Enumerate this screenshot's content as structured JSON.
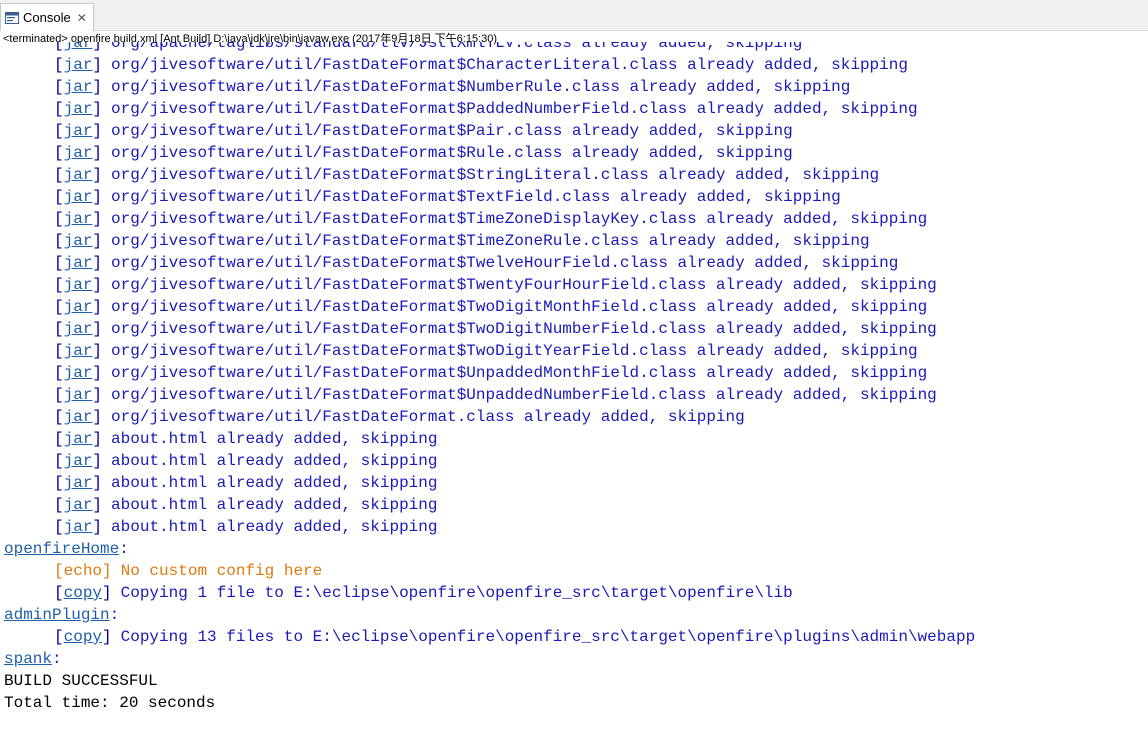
{
  "tab": {
    "label": "Console",
    "close": "✕"
  },
  "status": "<terminated> openfire build.xml [Ant Build] D:\\java\\jdk\\jre\\bin\\javaw.exe (2017年9月18日 下午6:15:30)",
  "colors": {
    "output": "#1a1ab8",
    "link": "#1f5fa8",
    "echo": "#e07a10",
    "text": "#000000"
  },
  "lines": [
    {
      "kind": "task",
      "tag": "jar",
      "text": "org/apache/taglibs/standard/tlv/JstlXmlTLV.class already added, skipping"
    },
    {
      "kind": "task",
      "tag": "jar",
      "text": "org/jivesoftware/util/FastDateFormat$CharacterLiteral.class already added, skipping"
    },
    {
      "kind": "task",
      "tag": "jar",
      "text": "org/jivesoftware/util/FastDateFormat$NumberRule.class already added, skipping"
    },
    {
      "kind": "task",
      "tag": "jar",
      "text": "org/jivesoftware/util/FastDateFormat$PaddedNumberField.class already added, skipping"
    },
    {
      "kind": "task",
      "tag": "jar",
      "text": "org/jivesoftware/util/FastDateFormat$Pair.class already added, skipping"
    },
    {
      "kind": "task",
      "tag": "jar",
      "text": "org/jivesoftware/util/FastDateFormat$Rule.class already added, skipping"
    },
    {
      "kind": "task",
      "tag": "jar",
      "text": "org/jivesoftware/util/FastDateFormat$StringLiteral.class already added, skipping"
    },
    {
      "kind": "task",
      "tag": "jar",
      "text": "org/jivesoftware/util/FastDateFormat$TextField.class already added, skipping"
    },
    {
      "kind": "task",
      "tag": "jar",
      "text": "org/jivesoftware/util/FastDateFormat$TimeZoneDisplayKey.class already added, skipping"
    },
    {
      "kind": "task",
      "tag": "jar",
      "text": "org/jivesoftware/util/FastDateFormat$TimeZoneRule.class already added, skipping"
    },
    {
      "kind": "task",
      "tag": "jar",
      "text": "org/jivesoftware/util/FastDateFormat$TwelveHourField.class already added, skipping"
    },
    {
      "kind": "task",
      "tag": "jar",
      "text": "org/jivesoftware/util/FastDateFormat$TwentyFourHourField.class already added, skipping"
    },
    {
      "kind": "task",
      "tag": "jar",
      "text": "org/jivesoftware/util/FastDateFormat$TwoDigitMonthField.class already added, skipping"
    },
    {
      "kind": "task",
      "tag": "jar",
      "text": "org/jivesoftware/util/FastDateFormat$TwoDigitNumberField.class already added, skipping"
    },
    {
      "kind": "task",
      "tag": "jar",
      "text": "org/jivesoftware/util/FastDateFormat$TwoDigitYearField.class already added, skipping"
    },
    {
      "kind": "task",
      "tag": "jar",
      "text": "org/jivesoftware/util/FastDateFormat$UnpaddedMonthField.class already added, skipping"
    },
    {
      "kind": "task",
      "tag": "jar",
      "text": "org/jivesoftware/util/FastDateFormat$UnpaddedNumberField.class already added, skipping"
    },
    {
      "kind": "task",
      "tag": "jar",
      "text": "org/jivesoftware/util/FastDateFormat.class already added, skipping"
    },
    {
      "kind": "task",
      "tag": "jar",
      "text": "about.html already added, skipping"
    },
    {
      "kind": "task",
      "tag": "jar",
      "text": "about.html already added, skipping"
    },
    {
      "kind": "task",
      "tag": "jar",
      "text": "about.html already added, skipping"
    },
    {
      "kind": "task",
      "tag": "jar",
      "text": "about.html already added, skipping"
    },
    {
      "kind": "task",
      "tag": "jar",
      "text": "about.html already added, skipping"
    },
    {
      "kind": "target",
      "name": "openfireHome"
    },
    {
      "kind": "echo",
      "tag": "echo",
      "text": "No custom config here"
    },
    {
      "kind": "task",
      "tag": "copy",
      "text": "Copying 1 file to E:\\eclipse\\openfire\\openfire_src\\target\\openfire\\lib"
    },
    {
      "kind": "target",
      "name": "adminPlugin"
    },
    {
      "kind": "task",
      "tag": "copy",
      "text": "Copying 13 files to E:\\eclipse\\openfire\\openfire_src\\target\\openfire\\plugins\\admin\\webapp"
    },
    {
      "kind": "target",
      "name": "spank"
    },
    {
      "kind": "plain",
      "text": "BUILD SUCCESSFUL"
    },
    {
      "kind": "plain",
      "text": "Total time: 20 seconds"
    }
  ]
}
